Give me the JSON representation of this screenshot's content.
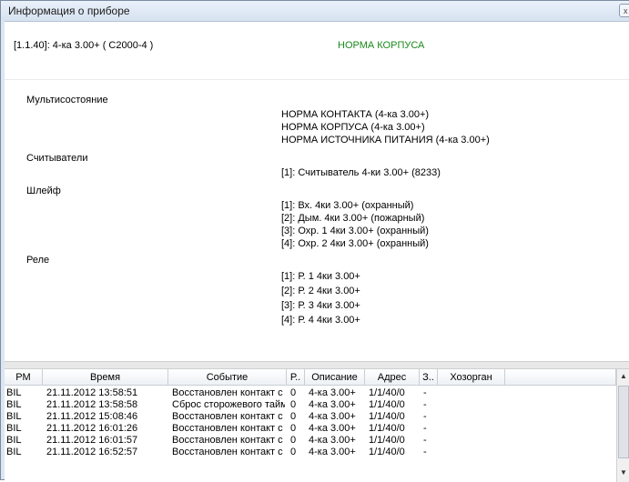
{
  "window": {
    "title": "Информация о приборе",
    "close_glyph": "x",
    "close_icon": "close-icon"
  },
  "device": {
    "name": "[1.1.40]: 4-ка 3.00+ ( С2000-4 )",
    "status": "НОРМА КОРПУСА",
    "status_color": "#1a8a1a"
  },
  "sections": {
    "multistate": {
      "label": "Мультисостояние",
      "values": [
        "НОРМА КОНТАКТА (4-ка 3.00+)",
        "НОРМА КОРПУСА (4-ка 3.00+)",
        "НОРМА ИСТОЧНИКА ПИТАНИЯ (4-ка 3.00+)"
      ]
    },
    "readers": {
      "label": "Считыватели",
      "values": [
        "[1]: Считыватель 4-ки 3.00+ (8233)"
      ]
    },
    "loops": {
      "label": "Шлейф",
      "values": [
        "[1]: Вх. 4ки 3.00+ (охранный)",
        "[2]: Дым. 4ки 3.00+ (пожарный)",
        "[3]: Охр. 1 4ки 3.00+ (охранный)",
        "[4]: Охр. 2 4ки 3.00+ (охранный)"
      ]
    },
    "relays": {
      "label": "Реле",
      "values": [
        "[1]: Р. 1 4ки 3.00+",
        "[2]: Р. 2 4ки 3.00+",
        "[3]: Р. 3 4ки 3.00+",
        "[4]: Р. 4 4ки 3.00+"
      ]
    }
  },
  "events": {
    "columns": [
      "РМ",
      "Время",
      "Событие",
      "Р..",
      "Описание",
      "Адрес",
      "З..",
      "Хозорган"
    ],
    "rows": [
      [
        "BIL",
        "21.11.2012 13:58:51",
        "Восстановлен контакт с ...",
        "0",
        "4-ка 3.00+",
        "1/1/40/0",
        "-",
        ""
      ],
      [
        "BIL",
        "21.11.2012 13:58:58",
        "Сброс сторожевого тайм...",
        "0",
        "4-ка 3.00+",
        "1/1/40/0",
        "-",
        ""
      ],
      [
        "BIL",
        "21.11.2012 15:08:46",
        "Восстановлен контакт с ...",
        "0",
        "4-ка 3.00+",
        "1/1/40/0",
        "-",
        ""
      ],
      [
        "BIL",
        "21.11.2012 16:01:26",
        "Восстановлен контакт с ...",
        "0",
        "4-ка 3.00+",
        "1/1/40/0",
        "-",
        ""
      ],
      [
        "BIL",
        "21.11.2012 16:01:57",
        "Восстановлен контакт с ...",
        "0",
        "4-ка 3.00+",
        "1/1/40/0",
        "-",
        ""
      ],
      [
        "BIL",
        "21.11.2012 16:52:57",
        "Восстановлен контакт с ...",
        "0",
        "4-ка 3.00+",
        "1/1/40/0",
        "-",
        ""
      ]
    ]
  },
  "scrollbar": {
    "up_glyph": "▲",
    "down_glyph": "▼"
  }
}
